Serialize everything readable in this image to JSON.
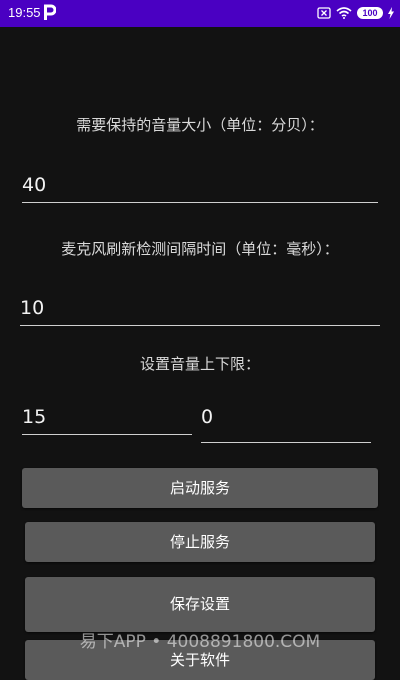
{
  "status_bar": {
    "time": "19:55",
    "battery": "100"
  },
  "form": {
    "volume_label": "需要保持的音量大小（单位：分贝）：",
    "volume_value": "40",
    "interval_label": "麦克风刷新检测间隔时间（单位：毫秒）：",
    "interval_value": "10",
    "range_label": "设置音量上下限：",
    "range_upper_value": "15",
    "range_lower_value": "0"
  },
  "buttons": {
    "start": "启动服务",
    "stop": "停止服务",
    "save": "保存设置",
    "close": "关于软件"
  },
  "watermark": "易下APP • 4008891800.COM"
}
